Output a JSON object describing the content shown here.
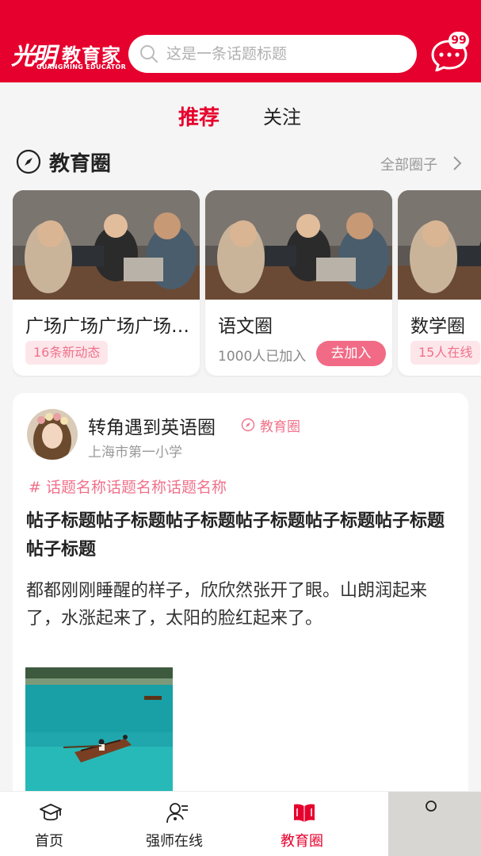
{
  "header": {
    "logo_script": "光明",
    "logo_cn": "教育家",
    "logo_en": "GUANGMING EDUCATOR",
    "search_placeholder": "这是一条话题标题",
    "message_badge": "99"
  },
  "tabs": {
    "recommend": "推荐",
    "follow": "关注",
    "active": "推荐"
  },
  "section": {
    "title": "教育圈",
    "more": "全部圈子"
  },
  "circles": [
    {
      "name": "广场广场广场广场广场",
      "tag": "16条新动态"
    },
    {
      "name": "语文圈",
      "members": "1000人已加入",
      "action": "去加入"
    },
    {
      "name": "数学圈",
      "tag": "15人在线"
    }
  ],
  "post": {
    "author": "转角遇到英语圈",
    "circle_tag": "教育圈",
    "school": "上海市第一小学",
    "topic": "# 话题名称话题名称话题名称",
    "title": "帖子标题帖子标题帖子标题帖子标题帖子标题帖子标题帖子标题",
    "body": "都都刚刚睡醒的样子，欣欣然张开了眼。山朗润起来了，水涨起来了，太阳的脸红起来了。"
  },
  "nav": {
    "home": "首页",
    "teacher": "强师在线",
    "edu_circle": "教育圈",
    "active": "教育圈"
  },
  "colors": {
    "brand_red": "#e6002d",
    "accent_pink": "#f0718a",
    "tag_bg": "#fde6ea"
  }
}
